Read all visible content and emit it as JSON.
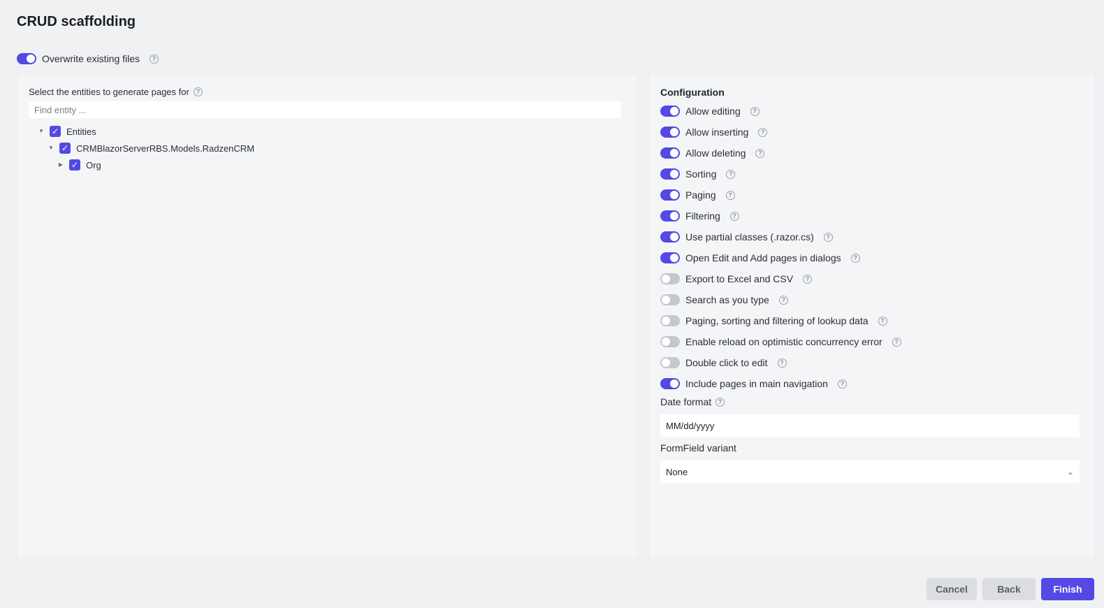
{
  "title": "CRUD scaffolding",
  "overwrite": {
    "label": "Overwrite existing files",
    "on": true
  },
  "entities": {
    "label": "Select the entities to generate pages for",
    "search_placeholder": "Find entity ...",
    "tree": [
      {
        "label": "Entities",
        "caret": "expanded",
        "checked": true
      },
      {
        "label": "CRMBlazorServerRBS.Models.RadzenCRM",
        "caret": "expanded",
        "checked": true
      },
      {
        "label": "Org",
        "caret": "collapsed",
        "checked": true
      }
    ]
  },
  "configuration": {
    "title": "Configuration",
    "options": [
      {
        "label": "Allow editing",
        "on": true
      },
      {
        "label": "Allow inserting",
        "on": true
      },
      {
        "label": "Allow deleting",
        "on": true
      },
      {
        "label": "Sorting",
        "on": true
      },
      {
        "label": "Paging",
        "on": true
      },
      {
        "label": "Filtering",
        "on": true
      },
      {
        "label": "Use partial classes (.razor.cs)",
        "on": true
      },
      {
        "label": "Open Edit and Add pages in dialogs",
        "on": true
      },
      {
        "label": "Export to Excel and CSV",
        "on": false
      },
      {
        "label": "Search as you type",
        "on": false
      },
      {
        "label": "Paging, sorting and filtering of lookup data",
        "on": false
      },
      {
        "label": "Enable reload on optimistic concurrency error",
        "on": false
      },
      {
        "label": "Double click to edit",
        "on": false
      },
      {
        "label": "Include pages in main navigation",
        "on": true
      }
    ],
    "date_format": {
      "label": "Date format",
      "value": "MM/dd/yyyy"
    },
    "formfield_variant": {
      "label": "FormField variant",
      "value": "None"
    }
  },
  "buttons": {
    "cancel": "Cancel",
    "back": "Back",
    "finish": "Finish"
  },
  "help_icon_glyph": "?",
  "check_glyph": "✓",
  "colors": {
    "accent": "#5449e4",
    "switch_off": "#c4c7cc",
    "background": "#f0f1f3",
    "panel": "#f4f5f7"
  }
}
